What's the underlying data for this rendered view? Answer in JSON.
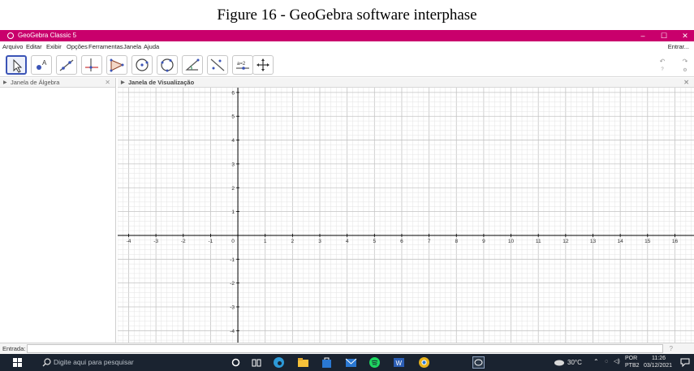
{
  "caption": "Figure 16 - GeoGebra software interphase",
  "window": {
    "title": "GeoGebra Classic 5",
    "controls": {
      "minimize": "–",
      "maximize": "☐",
      "close": "✕"
    }
  },
  "menubar": {
    "items": [
      "Arquivo",
      "Editar",
      "Exibir",
      "Opções",
      "Ferramentas",
      "Janela",
      "Ajuda"
    ],
    "login": "Entrar..."
  },
  "toolbar": {
    "tools": [
      "move-tool",
      "point-tool",
      "line-tool",
      "perpendicular-line-tool",
      "polygon-tool",
      "circle-tool",
      "circle-through-points-tool",
      "angle-tool",
      "reflect-tool",
      "slider-tool",
      "move-graphics-view-tool"
    ],
    "slider_label": "a=2",
    "undo": "↶",
    "redo": "↷",
    "help": "?",
    "settings": "⚙"
  },
  "algebra_panel": {
    "title": "Janela de Álgebra",
    "close": "✕"
  },
  "graphics_panel": {
    "title": "Janela de Visualização",
    "close": "✕"
  },
  "axes": {
    "x_min": -4.4,
    "x_max": 16.7,
    "y_min": -4.5,
    "y_max": 6.2,
    "x_ticks": [
      -4,
      -3,
      -2,
      -1,
      0,
      1,
      2,
      3,
      4,
      5,
      6,
      7,
      8,
      9,
      10,
      11,
      12,
      13,
      14,
      15,
      16
    ],
    "y_ticks": [
      -4,
      -3,
      -2,
      -1,
      1,
      2,
      3,
      4,
      5,
      6
    ],
    "grid": true,
    "minor_divisions": 5
  },
  "input_bar": {
    "label": "Entrada:",
    "value": "",
    "help": "?"
  },
  "taskbar": {
    "search_placeholder": "Digite aqui para pesquisar",
    "weather": "30°C",
    "language_line1": "POR",
    "language_line2": "PTB2",
    "time": "11:26",
    "date": "03/12/2021",
    "app_icons": [
      "cortana-icon",
      "task-view-icon",
      "edge-icon",
      "file-explorer-icon",
      "store-icon",
      "mail-icon",
      "spotify-icon",
      "word-icon",
      "chrome-icon",
      "geogebra-icon"
    ],
    "colors": {
      "background": "#1a2330",
      "edge": "#2d9ad8",
      "explorer": "#f5c13a",
      "store": "#2a78d2",
      "mail": "#2a78d2",
      "spotify": "#1ed760",
      "word": "#2b5eb5",
      "chrome": "#e6b21d"
    }
  },
  "colors": {
    "title_bar": "#c9006c",
    "active_tool_border": "#3b54b6",
    "grid_minor": "#e3e3e3",
    "grid_major": "#c4c4c4",
    "axis": "#000000"
  }
}
